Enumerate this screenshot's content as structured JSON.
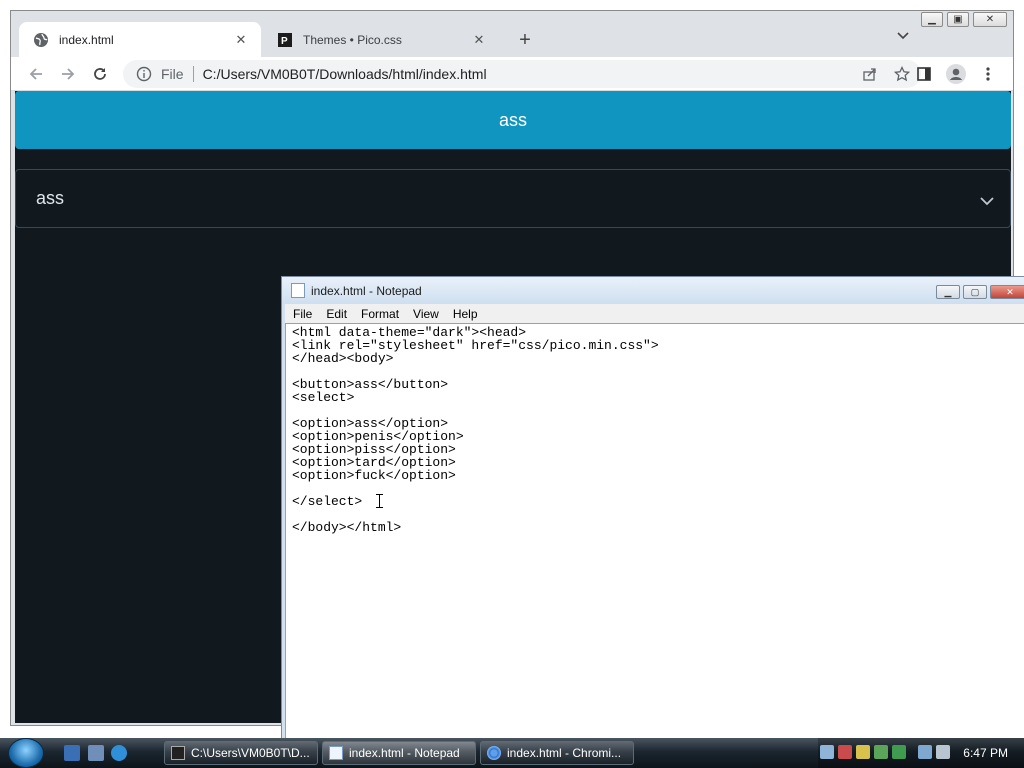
{
  "browser": {
    "tabs": [
      {
        "title": "index.html",
        "active": true
      },
      {
        "title": "Themes • Pico.css",
        "active": false
      }
    ],
    "address": {
      "scheme": "File",
      "url": "C:/Users/VM0B0T/Downloads/html/index.html"
    }
  },
  "page": {
    "button_label": "ass",
    "select_value": "ass",
    "colors": {
      "primary": "#1095c1",
      "background": "#11191f",
      "border": "#374956"
    }
  },
  "notepad": {
    "title": "index.html - Notepad",
    "menu": [
      "File",
      "Edit",
      "Format",
      "View",
      "Help"
    ],
    "lines": [
      "<html data-theme=\"dark\"><head>",
      "<link rel=\"stylesheet\" href=\"css/pico.min.css\">",
      "</head><body>",
      "",
      "<button>ass</button>",
      "<select>",
      "",
      "<option>ass</option>",
      "<option>penis</option>",
      "<option>piss</option>",
      "<option>tard</option>",
      "<option>fuck</option>",
      "",
      "</select> ",
      "",
      "</body></html>"
    ]
  },
  "taskbar": {
    "buttons": [
      {
        "label": "C:\\Users\\VM0B0T\\D...",
        "icon": "cmd-icon",
        "active": false
      },
      {
        "label": "index.html - Notepad",
        "icon": "notepad-icon",
        "active": true
      },
      {
        "label": "index.html - Chromi...",
        "icon": "chromium-icon",
        "active": false
      }
    ],
    "clock": "6:47 PM"
  }
}
